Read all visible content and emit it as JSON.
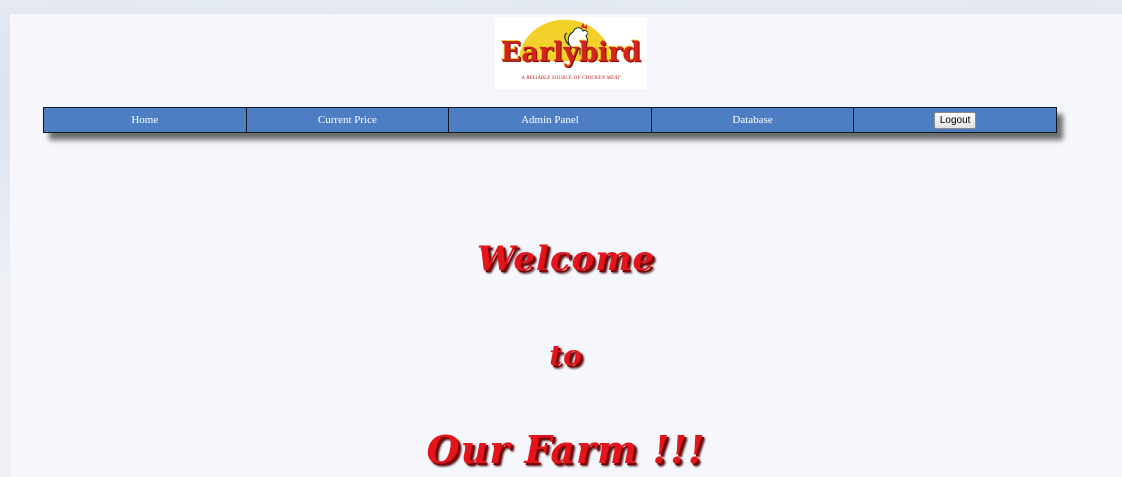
{
  "logo": {
    "wordmark": "Earlybird",
    "tagline": "A RELIABLE SOURCE OF CHICKEN MEAT"
  },
  "nav": {
    "items": [
      {
        "label": "Home"
      },
      {
        "label": "Current Price"
      },
      {
        "label": "Admin Panel"
      },
      {
        "label": "Database"
      }
    ],
    "logout_label": "Logout"
  },
  "welcome": {
    "line1": "Welcome",
    "line2": "to",
    "line3": "Our Farm !!!"
  },
  "colors": {
    "nav_blue": "#4d7ec4",
    "welcome_red": "#e3141a",
    "logo_red": "#d4231a",
    "logo_yellow": "#f2d22a"
  }
}
